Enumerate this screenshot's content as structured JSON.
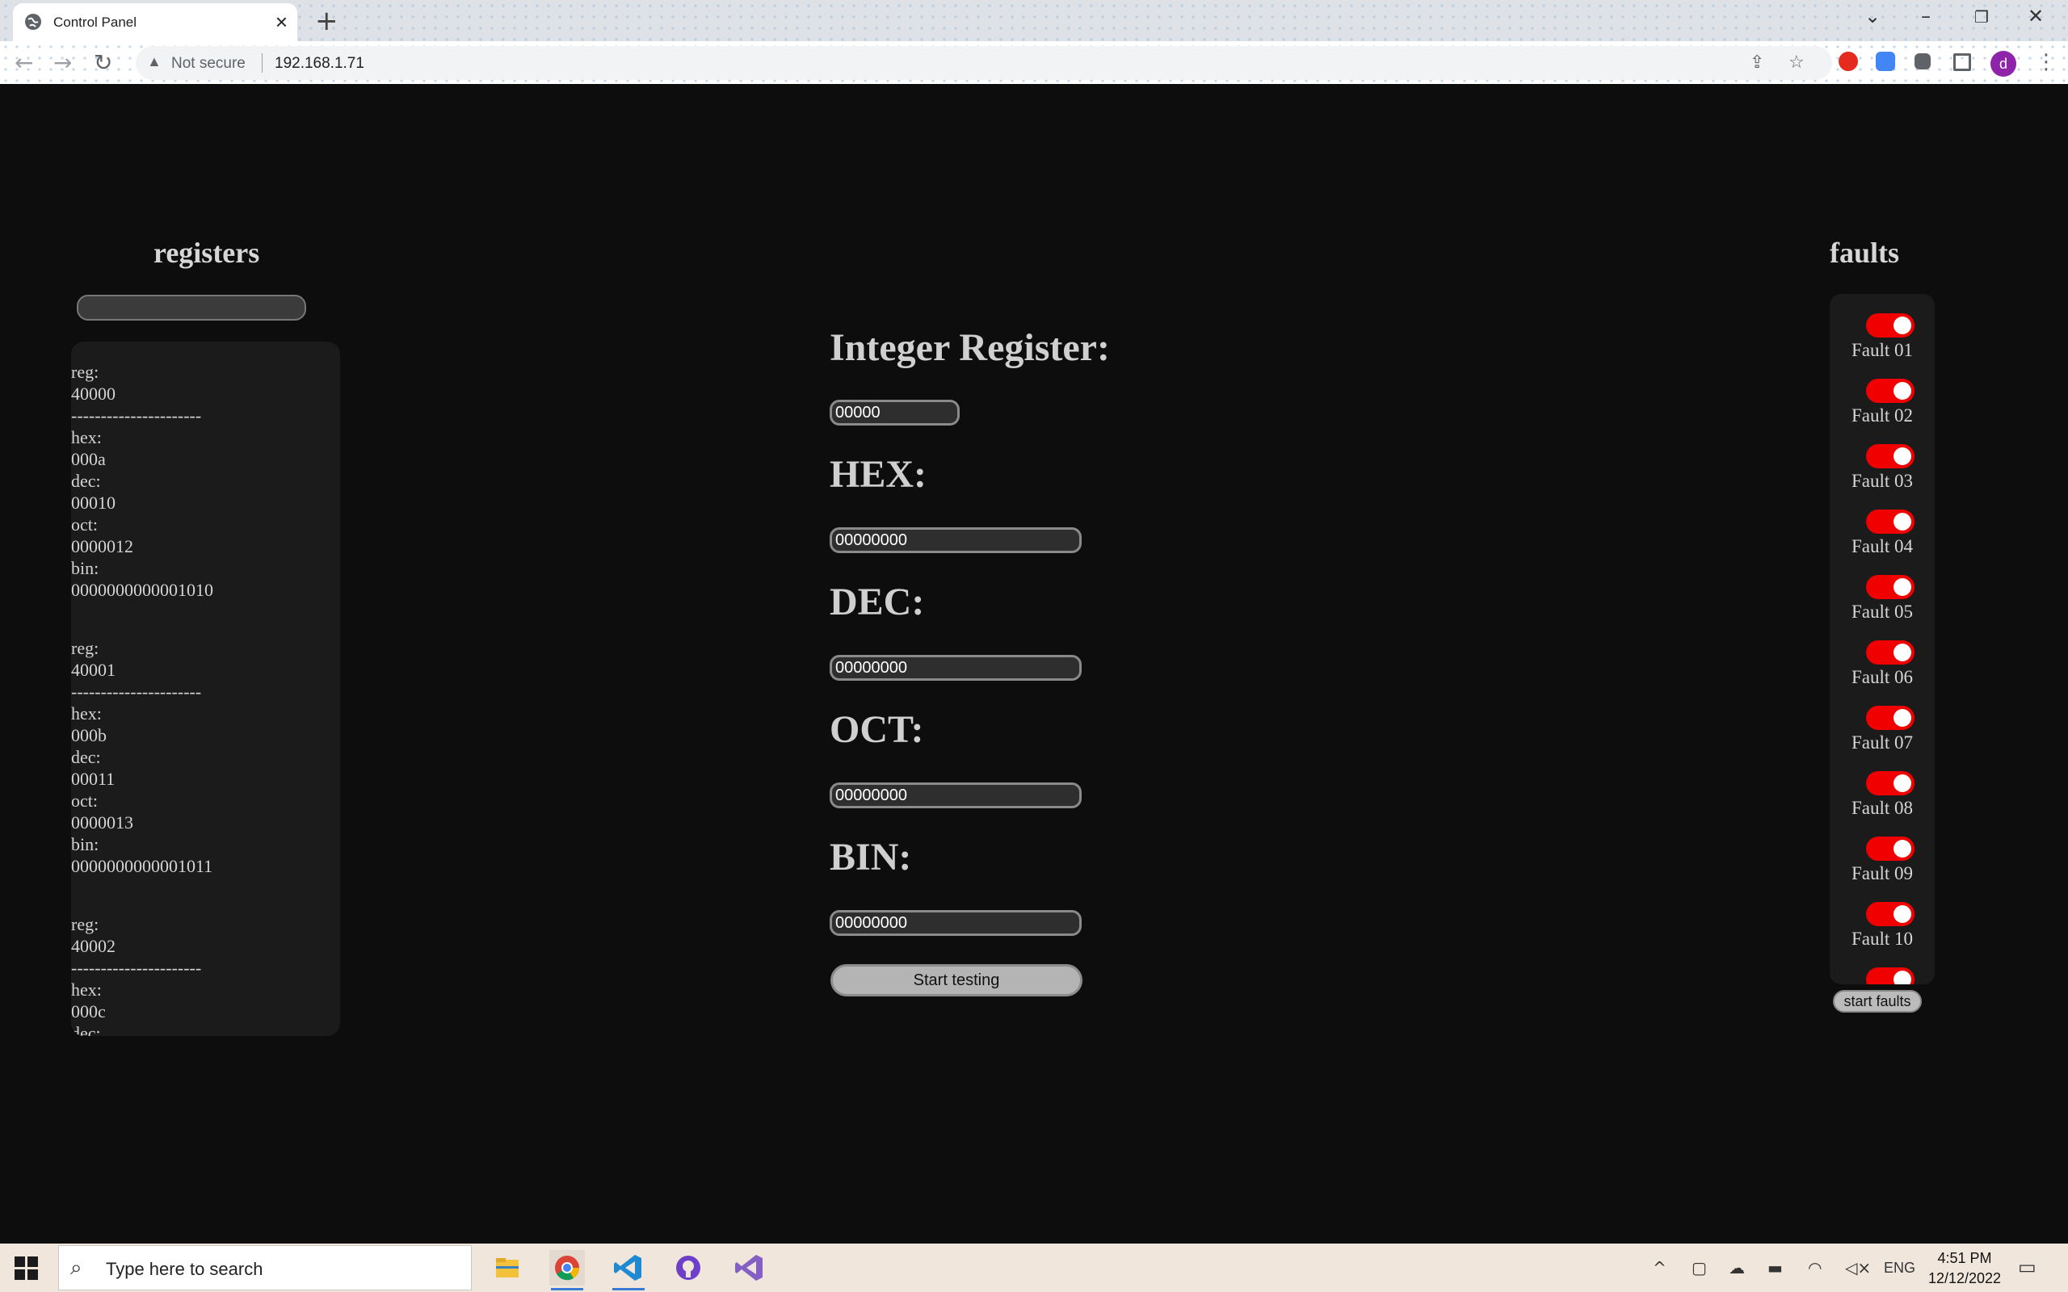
{
  "browser": {
    "tab_title": "Control Panel",
    "new_tab": "+",
    "not_secure": "Not secure",
    "url": "192.168.1.71",
    "profile_initial": "d"
  },
  "registers": {
    "heading": "registers",
    "items": [
      {
        "reg_label": "reg:",
        "reg": "40000",
        "divider": "----------------------",
        "hex_label": "hex:",
        "hex": "000a",
        "dec_label": "dec:",
        "dec": "00010",
        "oct_label": "oct:",
        "oct": "0000012",
        "bin_label": "bin:",
        "bin": "0000000000001010"
      },
      {
        "reg_label": "reg:",
        "reg": "40001",
        "divider": "----------------------",
        "hex_label": "hex:",
        "hex": "000b",
        "dec_label": "dec:",
        "dec": "00011",
        "oct_label": "oct:",
        "oct": "0000013",
        "bin_label": "bin:",
        "bin": "0000000000001011"
      },
      {
        "reg_label": "reg:",
        "reg": "40002",
        "divider": "----------------------",
        "hex_label": "hex:",
        "hex": "000c",
        "dec_label": "dec:"
      }
    ]
  },
  "main": {
    "integer_label": "Integer Register:",
    "integer_value": "00000",
    "hex_label": "HEX:",
    "hex_value": "00000000",
    "dec_label": "DEC:",
    "dec_value": "00000000",
    "oct_label": "OCT:",
    "oct_value": "00000000",
    "bin_label": "BIN:",
    "bin_value": "00000000",
    "start_testing": "Start testing"
  },
  "faults": {
    "heading": "faults",
    "items": [
      {
        "label": "Fault 01",
        "on": true
      },
      {
        "label": "Fault 02",
        "on": true
      },
      {
        "label": "Fault 03",
        "on": true
      },
      {
        "label": "Fault 04",
        "on": true
      },
      {
        "label": "Fault 05",
        "on": true
      },
      {
        "label": "Fault 06",
        "on": true
      },
      {
        "label": "Fault 07",
        "on": true
      },
      {
        "label": "Fault 08",
        "on": true
      },
      {
        "label": "Fault 09",
        "on": true
      },
      {
        "label": "Fault 10",
        "on": true
      },
      {
        "label": "",
        "on": true
      }
    ],
    "start_faults": "start faults",
    "toggle_color": "#f10000"
  },
  "taskbar": {
    "search_placeholder": "Type here to search",
    "language": "ENG",
    "time": "4:51 PM",
    "date": "12/12/2022"
  }
}
